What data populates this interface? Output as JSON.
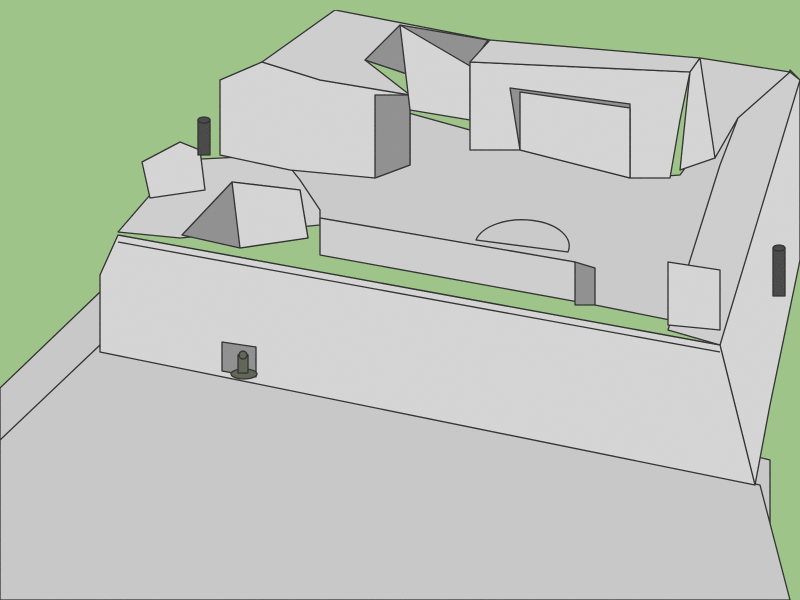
{
  "scene": {
    "background_color": "#9ec48a",
    "ground_color": "#c9c9c9",
    "wall_color": "#d6d6d6",
    "wall_top_color": "#cfcfcf",
    "floor_color": "#cbcbcb",
    "shadow_color": "#8e8e8e",
    "edge_color": "#1c1c1c",
    "chimney_color": "#3c3c3c",
    "figure_color": "#5a5f4e"
  }
}
